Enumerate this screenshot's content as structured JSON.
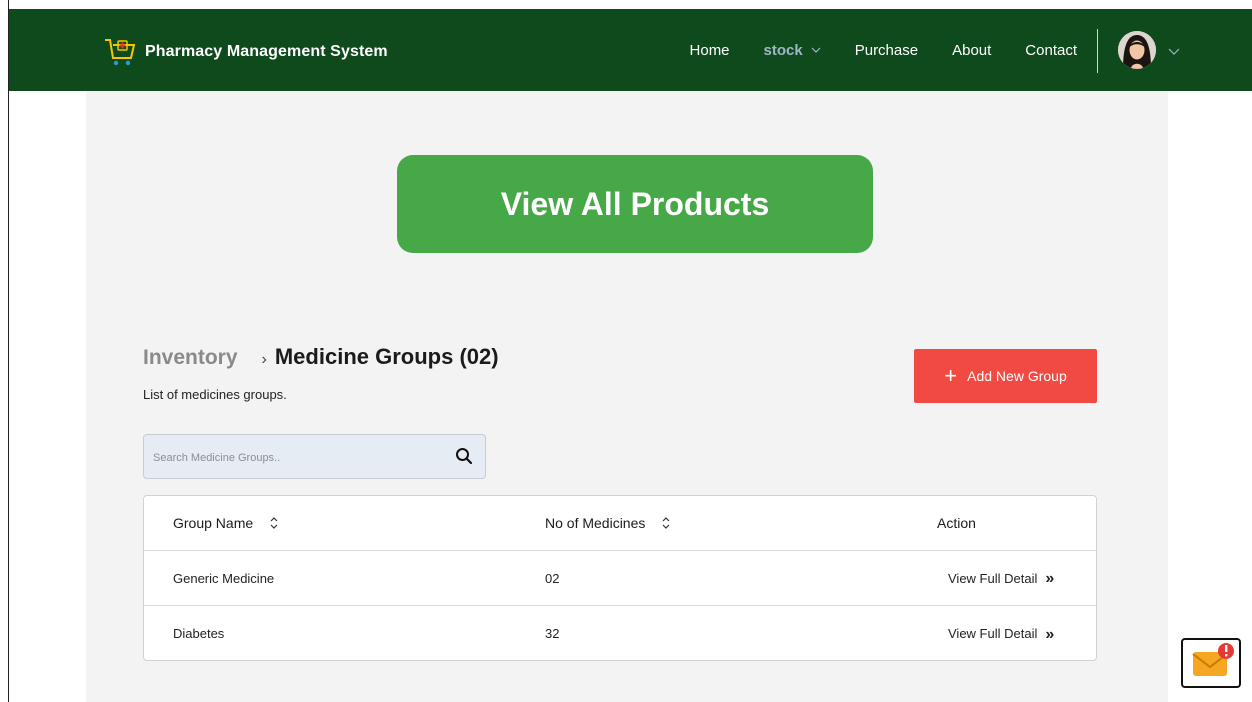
{
  "brand": {
    "title": "Pharmacy Management System"
  },
  "nav": {
    "items": [
      {
        "label": "Home"
      },
      {
        "label": "stock"
      },
      {
        "label": "Purchase"
      },
      {
        "label": "About"
      },
      {
        "label": "Contact"
      }
    ]
  },
  "hero": {
    "label": "View All Products"
  },
  "breadcrumb": {
    "parent": "Inventory",
    "separator": "›",
    "current": "Medicine Groups (02)"
  },
  "subtitle": "List of medicines groups.",
  "add_button": {
    "label": "Add New Group",
    "plus": "+"
  },
  "search": {
    "placeholder": "Search Medicine Groups.."
  },
  "table": {
    "headers": {
      "group_name": "Group Name",
      "count": "No of Medicines",
      "action": "Action"
    },
    "rows": [
      {
        "name": "Generic Medicine",
        "count": "02",
        "action": "View Full Detail",
        "arrows": "»"
      },
      {
        "name": "Diabetes",
        "count": "32",
        "action": "View Full Detail",
        "arrows": "»"
      }
    ]
  },
  "colors": {
    "navbar": "#0f4a1c",
    "hero": "#46a846",
    "add_button": "#f04a42",
    "panel": "#f3f3f3"
  },
  "icons": [
    "cart-plus-icon",
    "chevron-down-icon",
    "search-icon",
    "sort-icon",
    "double-chevron-right-icon",
    "mail-alert-icon"
  ]
}
